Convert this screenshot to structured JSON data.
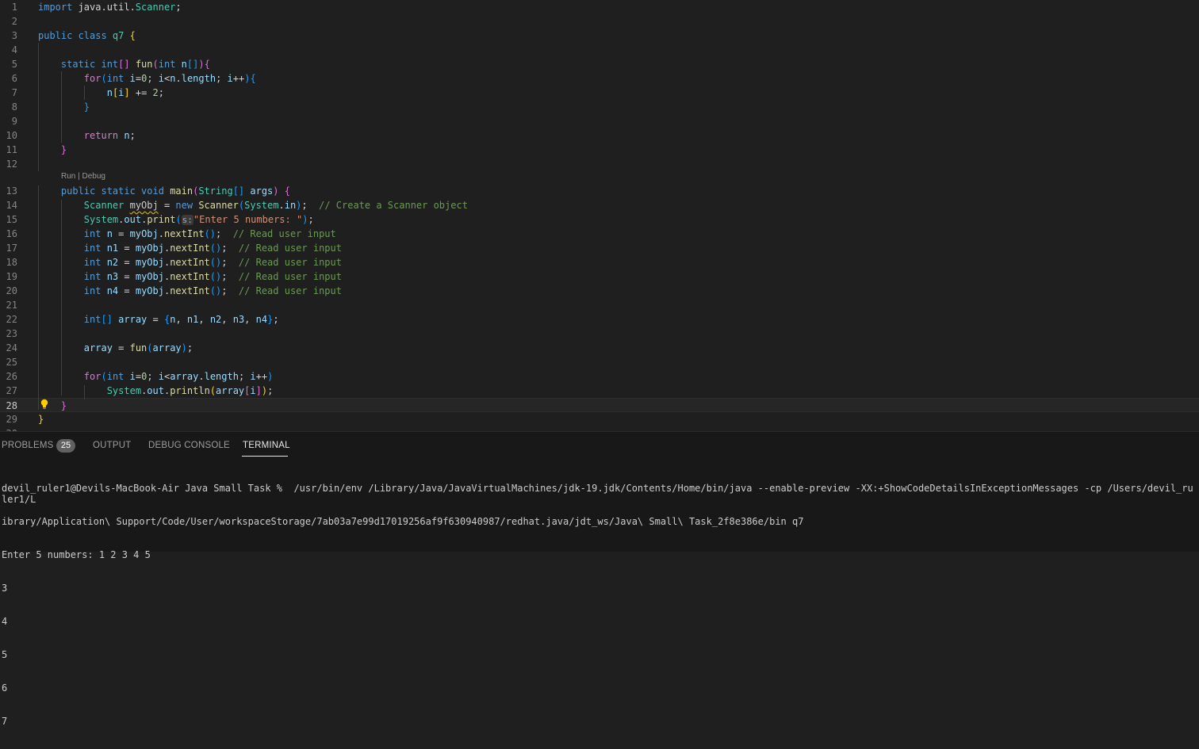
{
  "editor": {
    "codelens": "Run | Debug",
    "lines": [
      {
        "n": "1",
        "t": [
          [
            "kw",
            "import "
          ],
          [
            "pl",
            "java.util."
          ],
          [
            "ty",
            "Scanner"
          ],
          [
            "pl",
            ";"
          ]
        ]
      },
      {
        "n": "2",
        "t": []
      },
      {
        "n": "3",
        "t": [
          [
            "kw",
            "public class "
          ],
          [
            "ty",
            "q7 "
          ],
          [
            "br1",
            "{"
          ]
        ]
      },
      {
        "n": "4",
        "t": []
      },
      {
        "n": "5",
        "t": [
          [
            "pl",
            "    "
          ],
          [
            "kw",
            "static int"
          ],
          [
            "br2",
            "[]"
          ],
          [
            "fn",
            " fun"
          ],
          [
            "br2",
            "("
          ],
          [
            "kw",
            "int "
          ],
          [
            "var",
            "n"
          ],
          [
            "br3",
            "[]"
          ],
          [
            "br2",
            ")"
          ],
          [
            "br2",
            "{"
          ]
        ]
      },
      {
        "n": "6",
        "t": [
          [
            "pl",
            "        "
          ],
          [
            "ctl",
            "for"
          ],
          [
            "br3",
            "("
          ],
          [
            "kw",
            "int "
          ],
          [
            "var",
            "i"
          ],
          [
            "pl",
            "="
          ],
          [
            "num",
            "0"
          ],
          [
            "pl",
            "; "
          ],
          [
            "var",
            "i"
          ],
          [
            "pl",
            "<"
          ],
          [
            "var",
            "n"
          ],
          [
            "pl",
            "."
          ],
          [
            "var",
            "length"
          ],
          [
            "pl",
            "; "
          ],
          [
            "var",
            "i"
          ],
          [
            "pl",
            "++"
          ],
          [
            "br3",
            ")"
          ],
          [
            "br3",
            "{"
          ]
        ]
      },
      {
        "n": "7",
        "t": [
          [
            "pl",
            "            "
          ],
          [
            "var",
            "n"
          ],
          [
            "br1",
            "["
          ],
          [
            "var",
            "i"
          ],
          [
            "br1",
            "]"
          ],
          [
            "pl",
            " += "
          ],
          [
            "num",
            "2"
          ],
          [
            "pl",
            ";"
          ]
        ]
      },
      {
        "n": "8",
        "t": [
          [
            "pl",
            "        "
          ],
          [
            "br3",
            "}"
          ]
        ]
      },
      {
        "n": "9",
        "t": []
      },
      {
        "n": "10",
        "t": [
          [
            "pl",
            "        "
          ],
          [
            "ctl",
            "return "
          ],
          [
            "var",
            "n"
          ],
          [
            "pl",
            ";"
          ]
        ]
      },
      {
        "n": "11",
        "t": [
          [
            "pl",
            "    "
          ],
          [
            "br2",
            "}"
          ]
        ]
      },
      {
        "n": "12",
        "t": []
      },
      {
        "n": "13",
        "t": [
          [
            "pl",
            "    "
          ],
          [
            "kw",
            "public static void "
          ],
          [
            "fn",
            "main"
          ],
          [
            "br2",
            "("
          ],
          [
            "ty",
            "String"
          ],
          [
            "br3",
            "[]"
          ],
          [
            "var",
            " args"
          ],
          [
            "br2",
            ") "
          ],
          [
            "br2",
            "{"
          ]
        ]
      },
      {
        "n": "14",
        "t": [
          [
            "pl",
            "        "
          ],
          [
            "ty",
            "Scanner "
          ],
          [
            "squig",
            "myObj"
          ],
          [
            "pl",
            " = "
          ],
          [
            "kw",
            "new "
          ],
          [
            "fn",
            "Scanner"
          ],
          [
            "br3",
            "("
          ],
          [
            "ty",
            "System"
          ],
          [
            "pl",
            "."
          ],
          [
            "var",
            "in"
          ],
          [
            "br3",
            ")"
          ],
          [
            "pl",
            ";  "
          ],
          [
            "cm",
            "// Create a Scanner object"
          ]
        ]
      },
      {
        "n": "15",
        "t": [
          [
            "pl",
            "        "
          ],
          [
            "ty",
            "System"
          ],
          [
            "pl",
            "."
          ],
          [
            "var",
            "out"
          ],
          [
            "pl",
            "."
          ],
          [
            "fn",
            "print"
          ],
          [
            "br3",
            "("
          ],
          [
            "hint",
            "s:"
          ],
          [
            "str",
            "\"Enter 5 numbers: \""
          ],
          [
            "br3",
            ")"
          ],
          [
            "pl",
            ";"
          ]
        ]
      },
      {
        "n": "16",
        "t": [
          [
            "pl",
            "        "
          ],
          [
            "kw",
            "int "
          ],
          [
            "var",
            "n"
          ],
          [
            "pl",
            " = "
          ],
          [
            "var",
            "myObj"
          ],
          [
            "pl",
            "."
          ],
          [
            "fn",
            "nextInt"
          ],
          [
            "br3",
            "()"
          ],
          [
            "pl",
            ";  "
          ],
          [
            "cm",
            "// Read user input"
          ]
        ]
      },
      {
        "n": "17",
        "t": [
          [
            "pl",
            "        "
          ],
          [
            "kw",
            "int "
          ],
          [
            "var",
            "n1"
          ],
          [
            "pl",
            " = "
          ],
          [
            "var",
            "myObj"
          ],
          [
            "pl",
            "."
          ],
          [
            "fn",
            "nextInt"
          ],
          [
            "br3",
            "()"
          ],
          [
            "pl",
            ";  "
          ],
          [
            "cm",
            "// Read user input"
          ]
        ]
      },
      {
        "n": "18",
        "t": [
          [
            "pl",
            "        "
          ],
          [
            "kw",
            "int "
          ],
          [
            "var",
            "n2"
          ],
          [
            "pl",
            " = "
          ],
          [
            "var",
            "myObj"
          ],
          [
            "pl",
            "."
          ],
          [
            "fn",
            "nextInt"
          ],
          [
            "br3",
            "()"
          ],
          [
            "pl",
            ";  "
          ],
          [
            "cm",
            "// Read user input"
          ]
        ]
      },
      {
        "n": "19",
        "t": [
          [
            "pl",
            "        "
          ],
          [
            "kw",
            "int "
          ],
          [
            "var",
            "n3"
          ],
          [
            "pl",
            " = "
          ],
          [
            "var",
            "myObj"
          ],
          [
            "pl",
            "."
          ],
          [
            "fn",
            "nextInt"
          ],
          [
            "br3",
            "()"
          ],
          [
            "pl",
            ";  "
          ],
          [
            "cm",
            "// Read user input"
          ]
        ]
      },
      {
        "n": "20",
        "t": [
          [
            "pl",
            "        "
          ],
          [
            "kw",
            "int "
          ],
          [
            "var",
            "n4"
          ],
          [
            "pl",
            " = "
          ],
          [
            "var",
            "myObj"
          ],
          [
            "pl",
            "."
          ],
          [
            "fn",
            "nextInt"
          ],
          [
            "br3",
            "()"
          ],
          [
            "pl",
            ";  "
          ],
          [
            "cm",
            "// Read user input"
          ]
        ]
      },
      {
        "n": "21",
        "t": []
      },
      {
        "n": "22",
        "t": [
          [
            "pl",
            "        "
          ],
          [
            "kw",
            "int"
          ],
          [
            "br3",
            "[]"
          ],
          [
            "var",
            " array"
          ],
          [
            "pl",
            " = "
          ],
          [
            "br3",
            "{"
          ],
          [
            "var",
            "n"
          ],
          [
            "pl",
            ", "
          ],
          [
            "var",
            "n1"
          ],
          [
            "pl",
            ", "
          ],
          [
            "var",
            "n2"
          ],
          [
            "pl",
            ", "
          ],
          [
            "var",
            "n3"
          ],
          [
            "pl",
            ", "
          ],
          [
            "var",
            "n4"
          ],
          [
            "br3",
            "}"
          ],
          [
            "pl",
            ";"
          ]
        ]
      },
      {
        "n": "23",
        "t": []
      },
      {
        "n": "24",
        "t": [
          [
            "pl",
            "        "
          ],
          [
            "var",
            "array"
          ],
          [
            "pl",
            " = "
          ],
          [
            "fn",
            "fun"
          ],
          [
            "br3",
            "("
          ],
          [
            "var",
            "array"
          ],
          [
            "br3",
            ")"
          ],
          [
            "pl",
            ";"
          ]
        ]
      },
      {
        "n": "25",
        "t": []
      },
      {
        "n": "26",
        "t": [
          [
            "pl",
            "        "
          ],
          [
            "ctl",
            "for"
          ],
          [
            "br3",
            "("
          ],
          [
            "kw",
            "int "
          ],
          [
            "var",
            "i"
          ],
          [
            "pl",
            "="
          ],
          [
            "num",
            "0"
          ],
          [
            "pl",
            "; "
          ],
          [
            "var",
            "i"
          ],
          [
            "pl",
            "<"
          ],
          [
            "var",
            "array"
          ],
          [
            "pl",
            "."
          ],
          [
            "var",
            "length"
          ],
          [
            "pl",
            "; "
          ],
          [
            "var",
            "i"
          ],
          [
            "pl",
            "++"
          ],
          [
            "br3",
            ")"
          ]
        ]
      },
      {
        "n": "27",
        "t": [
          [
            "pl",
            "            "
          ],
          [
            "ty",
            "System"
          ],
          [
            "pl",
            "."
          ],
          [
            "var",
            "out"
          ],
          [
            "pl",
            "."
          ],
          [
            "fn",
            "println"
          ],
          [
            "br1",
            "("
          ],
          [
            "var",
            "array"
          ],
          [
            "br2",
            "["
          ],
          [
            "var",
            "i"
          ],
          [
            "br2",
            "]"
          ],
          [
            "br1",
            ")"
          ],
          [
            "pl",
            ";"
          ]
        ]
      },
      {
        "n": "28",
        "t": [
          [
            "pl",
            "    "
          ],
          [
            "br2",
            "}"
          ]
        ]
      },
      {
        "n": "29",
        "t": [
          [
            "br1",
            "}"
          ]
        ]
      },
      {
        "n": "30",
        "t": []
      }
    ]
  },
  "panel": {
    "tabs": {
      "problems": "PROBLEMS",
      "problems_count": "25",
      "output": "OUTPUT",
      "debug_console": "DEBUG CONSOLE",
      "terminal": "TERMINAL"
    },
    "terminal_lines": [
      "devil_ruler1@Devils-MacBook-Air Java Small Task %  /usr/bin/env /Library/Java/JavaVirtualMachines/jdk-19.jdk/Contents/Home/bin/java --enable-preview -XX:+ShowCodeDetailsInExceptionMessages -cp /Users/devil_ruler1/L",
      "ibrary/Application\\ Support/Code/User/workspaceStorage/7ab03a7e99d17019256af9f630940987/redhat.java/jdt_ws/Java\\ Small\\ Task_2f8e386e/bin q7",
      "Enter 5 numbers: 1 2 3 4 5",
      "3",
      "4",
      "5",
      "6",
      "7"
    ]
  }
}
